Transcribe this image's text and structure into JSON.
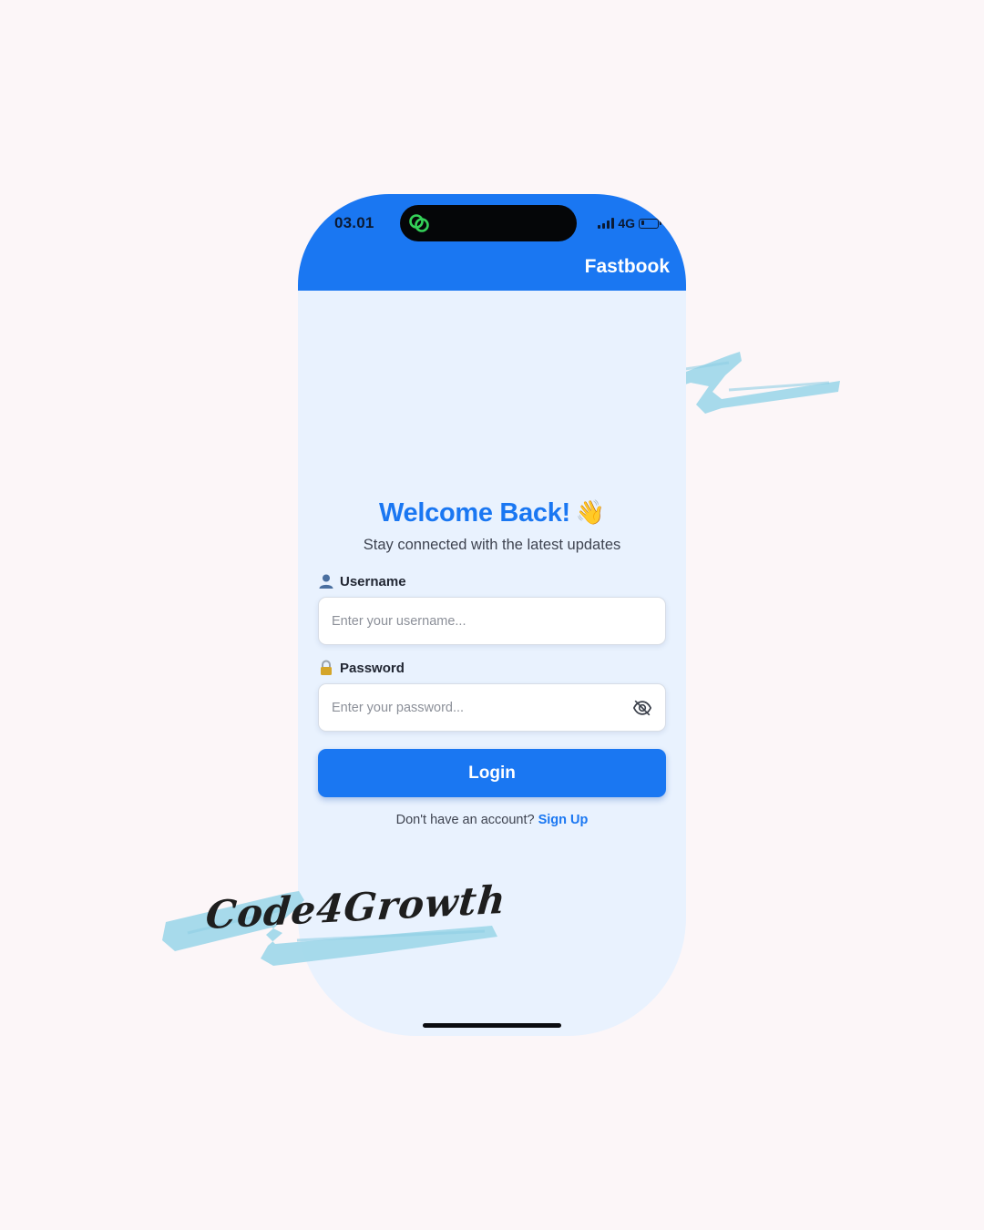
{
  "status_bar": {
    "time": "03.01",
    "network": "4G",
    "battery_level": 0.2
  },
  "header": {
    "brand": "Fastbook"
  },
  "login": {
    "title": "Welcome Back!",
    "title_emoji": "👋",
    "subtitle": "Stay connected with the latest updates",
    "username": {
      "icon": "👤",
      "label": "Username",
      "placeholder": "Enter your username...",
      "value": ""
    },
    "password": {
      "icon": "🔒",
      "label": "Password",
      "placeholder": "Enter your password...",
      "value": "",
      "visibility_icon": "eye-off-icon"
    },
    "submit_label": "Login",
    "signup_prompt": "Don't have an account?",
    "signup_link": "Sign Up"
  },
  "watermark": {
    "text": "Code4Growth"
  },
  "colors": {
    "primary": "#1a77f2",
    "page_background": "#fcf6f8",
    "screen_background": "#e9f2fe",
    "brush_accent": "#a2d8ea",
    "island_icon": "#34d058"
  }
}
